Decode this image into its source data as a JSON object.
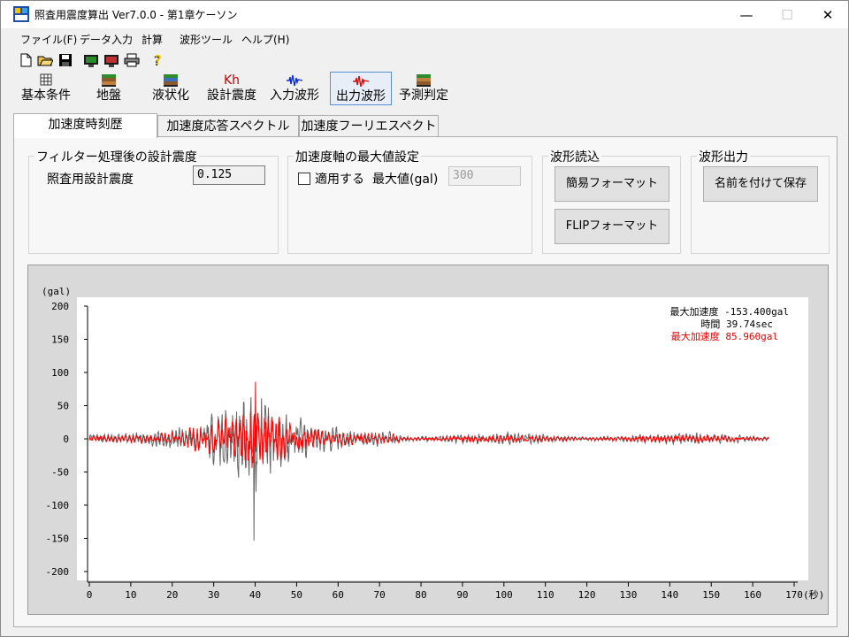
{
  "window": {
    "title": "照査用震度算出 Ver7.0.0 - 第1章ケーソン",
    "minimize_glyph": "—",
    "maximize_glyph": "☐",
    "close_glyph": "✕"
  },
  "menu": [
    "ファイル(F)",
    "データ入力",
    "計算",
    "波形ツール",
    "ヘルプ(H)"
  ],
  "toolbar_icons": [
    "new-file-icon",
    "open-folder-icon",
    "save-icon",
    "calc-icon",
    "monitor-icon",
    "print-icon",
    "help-icon"
  ],
  "toolbar2": [
    {
      "label": "基本条件",
      "icon": "grid-icon"
    },
    {
      "label": "地盤",
      "icon": "ground-layers-icon"
    },
    {
      "label": "液状化",
      "icon": "liquefaction-icon"
    },
    {
      "label": "設計震度",
      "icon_text": "Kh"
    },
    {
      "label": "入力波形",
      "icon": "input-wave-icon"
    },
    {
      "label": "出力波形",
      "icon": "output-wave-icon"
    },
    {
      "label": "予測判定",
      "icon": "prediction-icon"
    }
  ],
  "tabs": [
    "加速度時刻歴",
    "加速度応答スペクトル",
    "加速度フーリエスペクトル"
  ],
  "filter_group": {
    "title": "フィルター処理後の設計震度",
    "label": "照査用設計震度",
    "value": "0.125"
  },
  "axis_group": {
    "title": "加速度軸の最大値設定",
    "checkbox_label": "適用する",
    "max_label": "最大値(gal)",
    "max_value": "300"
  },
  "read_group": {
    "title": "波形読込",
    "btn_simple": "簡易フォーマット",
    "btn_flip": "FLIPフォーマット"
  },
  "output_group": {
    "title": "波形出力",
    "btn_save": "名前を付けて保存"
  },
  "chart_data": {
    "type": "line",
    "ylabel": "(gal)",
    "xlabel": "(秒)",
    "ylim": [
      -200,
      200
    ],
    "xlim": [
      0,
      170
    ],
    "yticks": [
      200,
      150,
      100,
      50,
      0,
      -50,
      -100,
      -150,
      -200
    ],
    "xticks": [
      0,
      10,
      20,
      30,
      40,
      50,
      60,
      70,
      80,
      90,
      100,
      110,
      120,
      130,
      140,
      150,
      160,
      170
    ],
    "series": [
      {
        "color": "#666666",
        "duration": 164,
        "peak": -153.4,
        "peak_time": 39.74
      },
      {
        "color": "#ff0000",
        "duration": 164,
        "peak": 85.96,
        "peak_time": 40.1
      }
    ],
    "annotations": {
      "line1": "最大加速度 -153.400gal",
      "line2": "時間 39.74sec",
      "line3": "最大加速度 85.960gal"
    }
  }
}
